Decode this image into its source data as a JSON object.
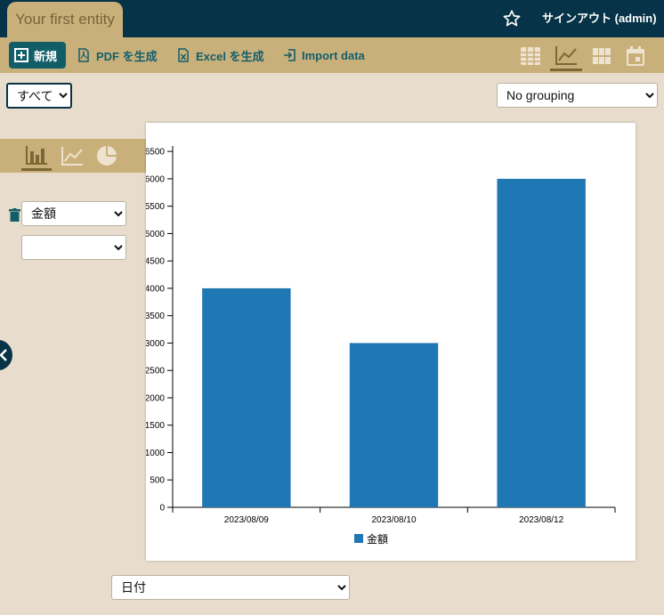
{
  "header": {
    "entity_tab": "Your first entity",
    "signout": "サインアウト (admin)"
  },
  "toolbar": {
    "new_label": "新規",
    "pdf_label": "PDF を生成",
    "excel_label": "Excel を生成",
    "import_label": "Import data"
  },
  "filters": {
    "filter_value": "すべて",
    "grouping_value": "No grouping"
  },
  "chart_config": {
    "y_field": "金額",
    "y_field_2": "",
    "x_field": "日付"
  },
  "colors": {
    "header": "#063347",
    "toolbar": "#c9b07b",
    "background": "#e8ddcc",
    "bar": "#1f77b4",
    "accent_button": "#125e68"
  },
  "icons": [
    "star-icon",
    "add-icon",
    "pdf-icon",
    "excel-icon",
    "import-icon",
    "table-view-icon",
    "chart-view-icon",
    "grid-view-icon",
    "calendar-view-icon",
    "bar-chart-icon",
    "line-chart-icon",
    "pie-chart-icon",
    "trash-icon",
    "chevron-left-icon"
  ],
  "chart_data": {
    "type": "bar",
    "categories": [
      "2023/08/09",
      "2023/08/10",
      "2023/08/12"
    ],
    "series": [
      {
        "name": "金額",
        "values": [
          4000,
          3000,
          6000
        ]
      }
    ],
    "yticks": [
      0,
      500,
      1000,
      1500,
      2000,
      2500,
      3000,
      3500,
      4000,
      4500,
      5000,
      5500,
      6000,
      6500
    ],
    "ylim": [
      0,
      6600
    ],
    "legend_position": "bottom",
    "grid": false
  }
}
